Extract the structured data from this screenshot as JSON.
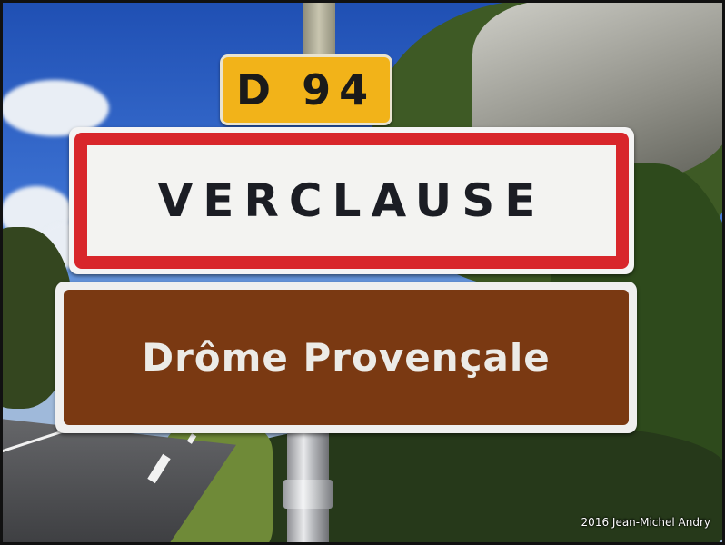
{
  "image": {
    "description_colors": {
      "route_sign": "#f2b319",
      "town_border": "#d8262b",
      "region_sign": "#7a3912"
    }
  },
  "signs": {
    "route_number": "D 94",
    "town_name": "VERCLAUSE",
    "region_name": "Drôme Provençale"
  },
  "credit": "2016 Jean-Michel Andry"
}
